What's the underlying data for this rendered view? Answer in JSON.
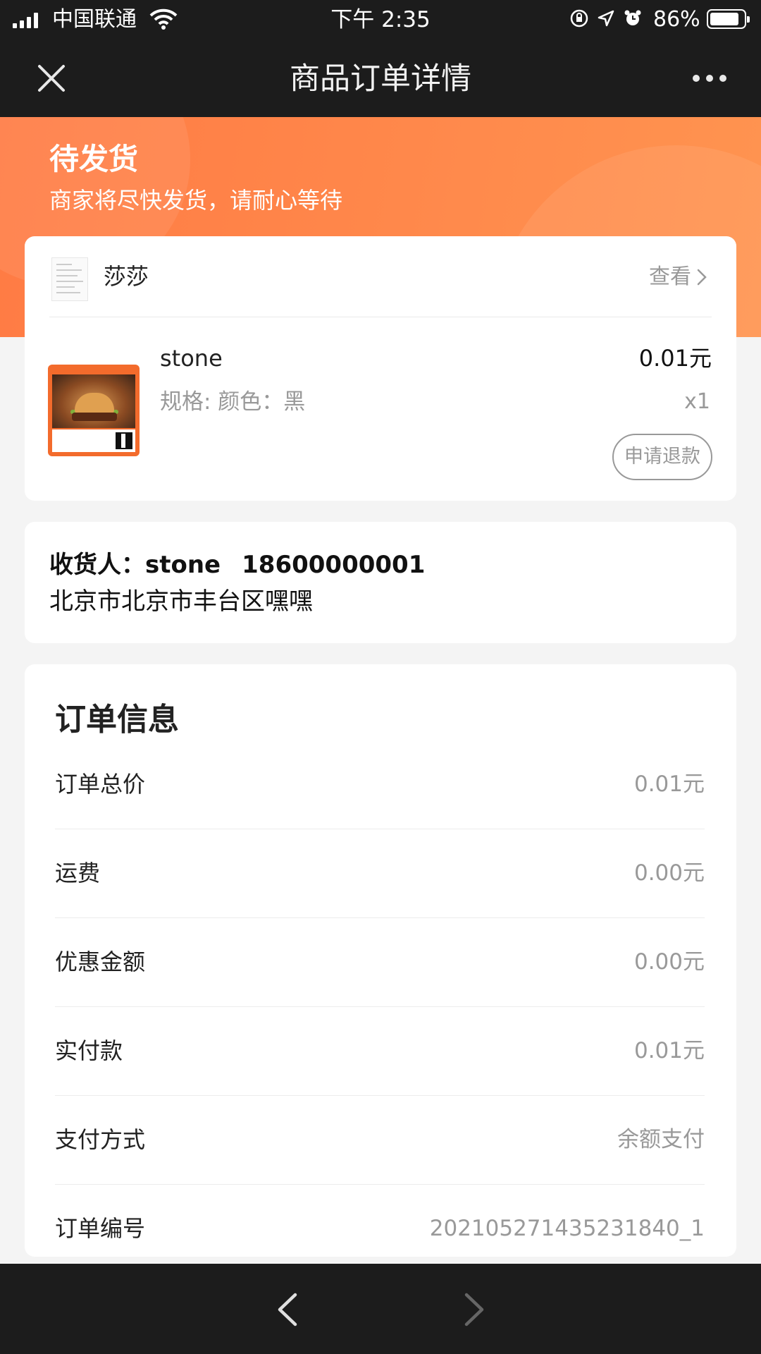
{
  "status_bar": {
    "carrier": "中国联通",
    "time": "下午 2:35",
    "battery_percent": "86%",
    "battery_level": 0.86,
    "icons": [
      "signal-icon",
      "wifi-icon",
      "rotation-lock-icon",
      "location-icon",
      "alarm-icon",
      "battery-icon"
    ]
  },
  "nav": {
    "title": "商品订单详情",
    "close_icon": "close-icon",
    "more_icon": "more-icon"
  },
  "order_status": {
    "state": "待发货",
    "description": "商家将尽快发货，请耐心等待"
  },
  "shop": {
    "name": "莎莎",
    "view_label": "查看"
  },
  "product": {
    "name": "stone",
    "price": "0.01元",
    "spec": "规格: 颜色：黑",
    "quantity": "x1",
    "refund_label": "申请退款"
  },
  "address": {
    "recipient_label": "收货人：",
    "recipient_name": "stone",
    "phone": "18600000001",
    "address": "北京市北京市丰台区嘿嘿"
  },
  "order_info": {
    "title": "订单信息",
    "rows": [
      {
        "label": "订单总价",
        "value": "0.01元"
      },
      {
        "label": "运费",
        "value": "0.00元"
      },
      {
        "label": "优惠金额",
        "value": "0.00元"
      },
      {
        "label": "实付款",
        "value": "0.01元"
      },
      {
        "label": "支付方式",
        "value": "余额支付"
      },
      {
        "label": "订单编号",
        "value": "20210527143523184​0_1"
      }
    ]
  },
  "bottom_bar": {
    "back_icon": "back-arrow-icon",
    "forward_icon": "forward-arrow-icon"
  },
  "colors": {
    "accent": "#ff7b44",
    "dark_bar": "#1c1c1c",
    "muted_text": "#999999",
    "page_bg": "#f4f4f4"
  }
}
